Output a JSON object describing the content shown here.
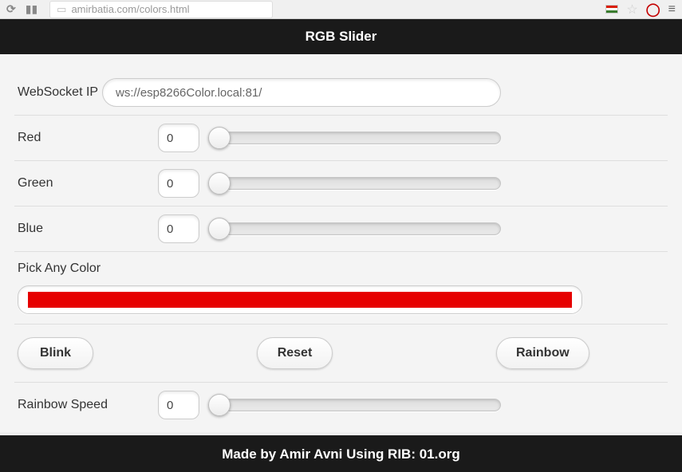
{
  "browser": {
    "url": "amirbatia.com/colors.html"
  },
  "header": {
    "title": "RGB Slider"
  },
  "websocket": {
    "label": "WebSocket IP",
    "value": "ws://esp8266Color.local:81/"
  },
  "red": {
    "label": "Red",
    "value": "0"
  },
  "green": {
    "label": "Green",
    "value": "0"
  },
  "blue": {
    "label": "Blue",
    "value": "0"
  },
  "color_picker": {
    "label": "Pick Any Color",
    "color": "#e60000"
  },
  "buttons": {
    "blink": "Blink",
    "reset": "Reset",
    "rainbow": "Rainbow"
  },
  "rainbow_speed": {
    "label": "Rainbow Speed",
    "value": "0"
  },
  "footer": {
    "text": "Made by Amir Avni Using RIB: 01.org"
  }
}
